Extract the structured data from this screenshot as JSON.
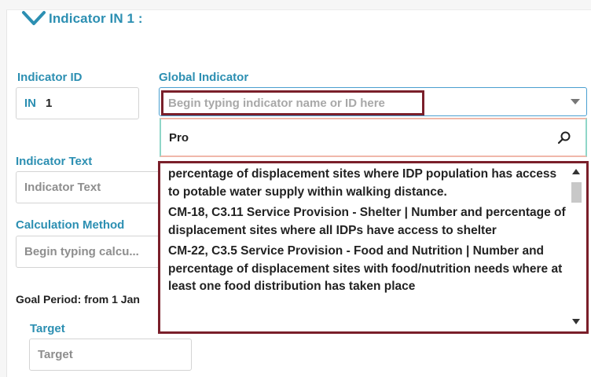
{
  "section": {
    "title": "Indicator IN 1 :"
  },
  "indicator_id": {
    "label": "Indicator ID",
    "prefix": "IN",
    "value": "1"
  },
  "global_indicator": {
    "label": "Global Indicator",
    "placeholder": "Begin typing indicator name or ID here",
    "search_value": "Pro",
    "results": [
      "percentage of displacement sites where IDP population has access to potable water supply within walking distance.",
      "CM-18, C3.11 Service Provision - Shelter | Number and percentage of displacement sites where all IDPs have access to shelter",
      "CM-22, C3.5 Service Provision - Food and Nutrition | Number and percentage of displacement sites with food/nutrition needs where at least one food distribution has taken place"
    ]
  },
  "indicator_text": {
    "label": "Indicator Text",
    "placeholder": "Indicator Text"
  },
  "calculation_method": {
    "label": "Calculation Method",
    "placeholder": "Begin typing calcu..."
  },
  "goal_period": {
    "text": "Goal Period: from 1 Jan"
  },
  "target": {
    "label": "Target",
    "placeholder": "Target"
  },
  "colors": {
    "accent": "#2c8fb2",
    "highlight_border": "#7a1f2a",
    "focus_border": "#4a9fd0"
  },
  "icons": {
    "collapse": "chevron-down-icon",
    "search": "search-icon",
    "dropdown": "caret-down-icon"
  }
}
